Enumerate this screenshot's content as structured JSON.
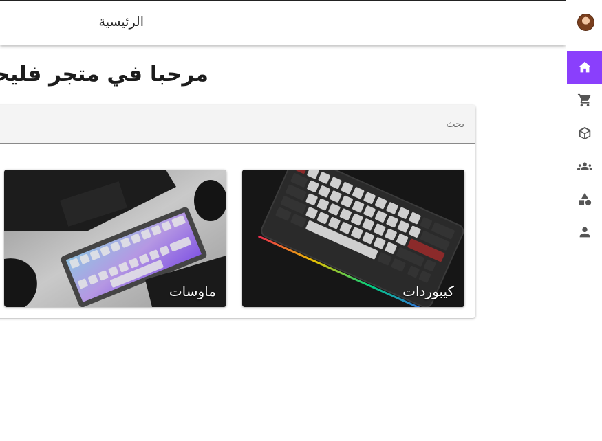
{
  "topbar": {
    "title": "الرئيسية"
  },
  "main": {
    "heading": "مرحبا في متجر فليحة"
  },
  "search": {
    "placeholder": "بحث"
  },
  "categories": [
    {
      "label": "كيبوردات"
    },
    {
      "label": "ماوسات"
    }
  ],
  "nav": {
    "active": "home",
    "active_color": "#8a3ffc",
    "items": [
      "home-icon",
      "cart-icon",
      "package-icon",
      "groups-icon",
      "shapes-icon",
      "person-icon"
    ]
  }
}
